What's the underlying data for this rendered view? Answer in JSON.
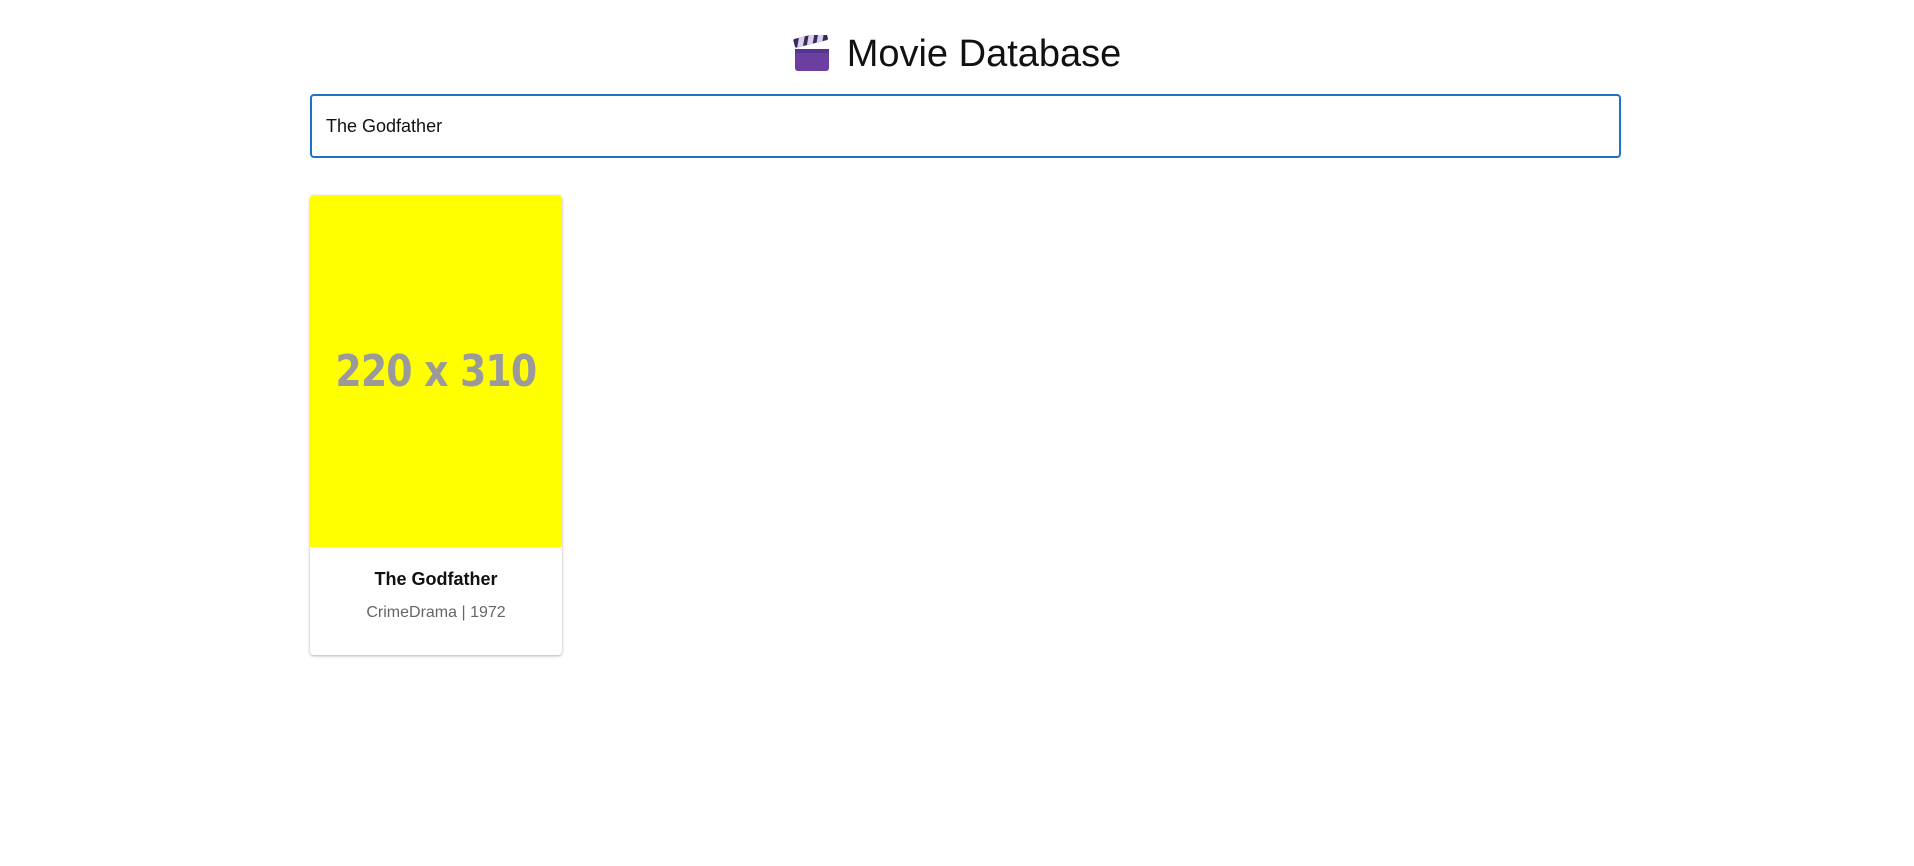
{
  "header": {
    "icon": "clapperboard-icon",
    "title": "Movie Database"
  },
  "search": {
    "value": "The Godfather",
    "focus_color": "#1a73c8"
  },
  "results": [
    {
      "poster_label": "220 x 310",
      "poster_color": "#ffff00",
      "title": "The Godfather",
      "meta": "CrimeDrama | 1972"
    }
  ]
}
